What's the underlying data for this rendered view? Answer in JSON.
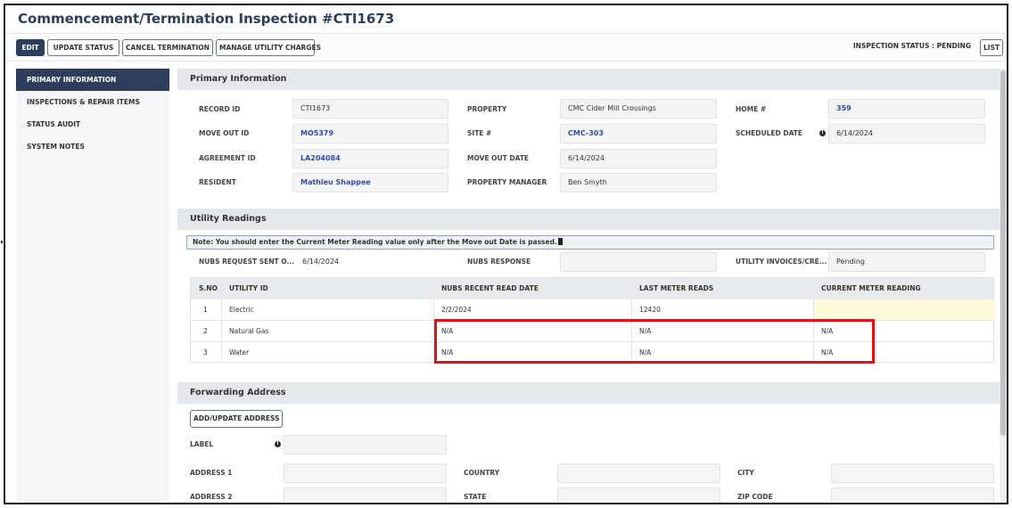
{
  "header": {
    "title": "Commencement/Termination Inspection #CTI1673"
  },
  "toolbar": {
    "edit": "EDIT",
    "update_status": "UPDATE STATUS",
    "cancel_termination": "CANCEL TERMINATION",
    "manage_utility": "MANAGE UTILITY CHARGES",
    "inspection_status": "INSPECTION STATUS : PENDING",
    "list": "LIST"
  },
  "sidebar": {
    "items": [
      {
        "label": "PRIMARY INFORMATION",
        "active": true
      },
      {
        "label": "INSPECTIONS & REPAIR ITEMS"
      },
      {
        "label": "STATUS AUDIT"
      },
      {
        "label": "SYSTEM NOTES"
      }
    ]
  },
  "primary": {
    "section_title": "Primary Information",
    "record_id": {
      "label": "RECORD ID",
      "value": "CTI1673"
    },
    "property": {
      "label": "PROPERTY",
      "value": "CMC Cider Mill Crossings"
    },
    "home": {
      "label": "HOME #",
      "value": "359"
    },
    "move_out_id": {
      "label": "MOVE OUT ID",
      "value": "MO5379"
    },
    "site": {
      "label": "SITE #",
      "value": "CMC-303"
    },
    "scheduled_date": {
      "label": "SCHEDULED DATE",
      "value": "6/14/2024"
    },
    "agreement_id": {
      "label": "AGREEMENT ID",
      "value": "LA204084"
    },
    "move_out_date": {
      "label": "MOVE OUT DATE",
      "value": "6/14/2024"
    },
    "resident": {
      "label": "RESIDENT",
      "value": "Mathieu Shappee"
    },
    "property_manager": {
      "label": "PROPERTY MANAGER",
      "value": "Ben Smyth"
    }
  },
  "utility": {
    "section_title": "Utility Readings",
    "note": "Note: You should enter the Current Meter Reading value only after the Move out Date is passed.",
    "nubs_request_sent": {
      "label": "NUBS REQUEST SENT O...",
      "value": "6/14/2024"
    },
    "nubs_response": {
      "label": "NUBS RESPONSE",
      "value": ""
    },
    "utility_invoices": {
      "label": "UTILITY INVOICES/CRE...",
      "value": "Pending"
    },
    "table": {
      "headers": [
        "S.NO",
        "UTILITY ID",
        "NUBS RECENT READ DATE",
        "LAST METER READS",
        "CURRENT METER READING"
      ],
      "rows": [
        [
          "1",
          "Electric",
          "2/2/2024",
          "12420",
          ""
        ],
        [
          "2",
          "Natural Gas",
          "N/A",
          "N/A",
          "N/A"
        ],
        [
          "3",
          "Water",
          "N/A",
          "N/A",
          "N/A"
        ]
      ]
    }
  },
  "forwarding": {
    "section_title": "Forwarding Address",
    "add_update_button": "ADD/UPDATE ADDRESS",
    "label_field": "LABEL",
    "address1": "ADDRESS 1",
    "country": "COUNTRY",
    "city": "CITY",
    "address2": "ADDRESS 2",
    "state": "STATE",
    "zip": "ZIP CODE"
  }
}
